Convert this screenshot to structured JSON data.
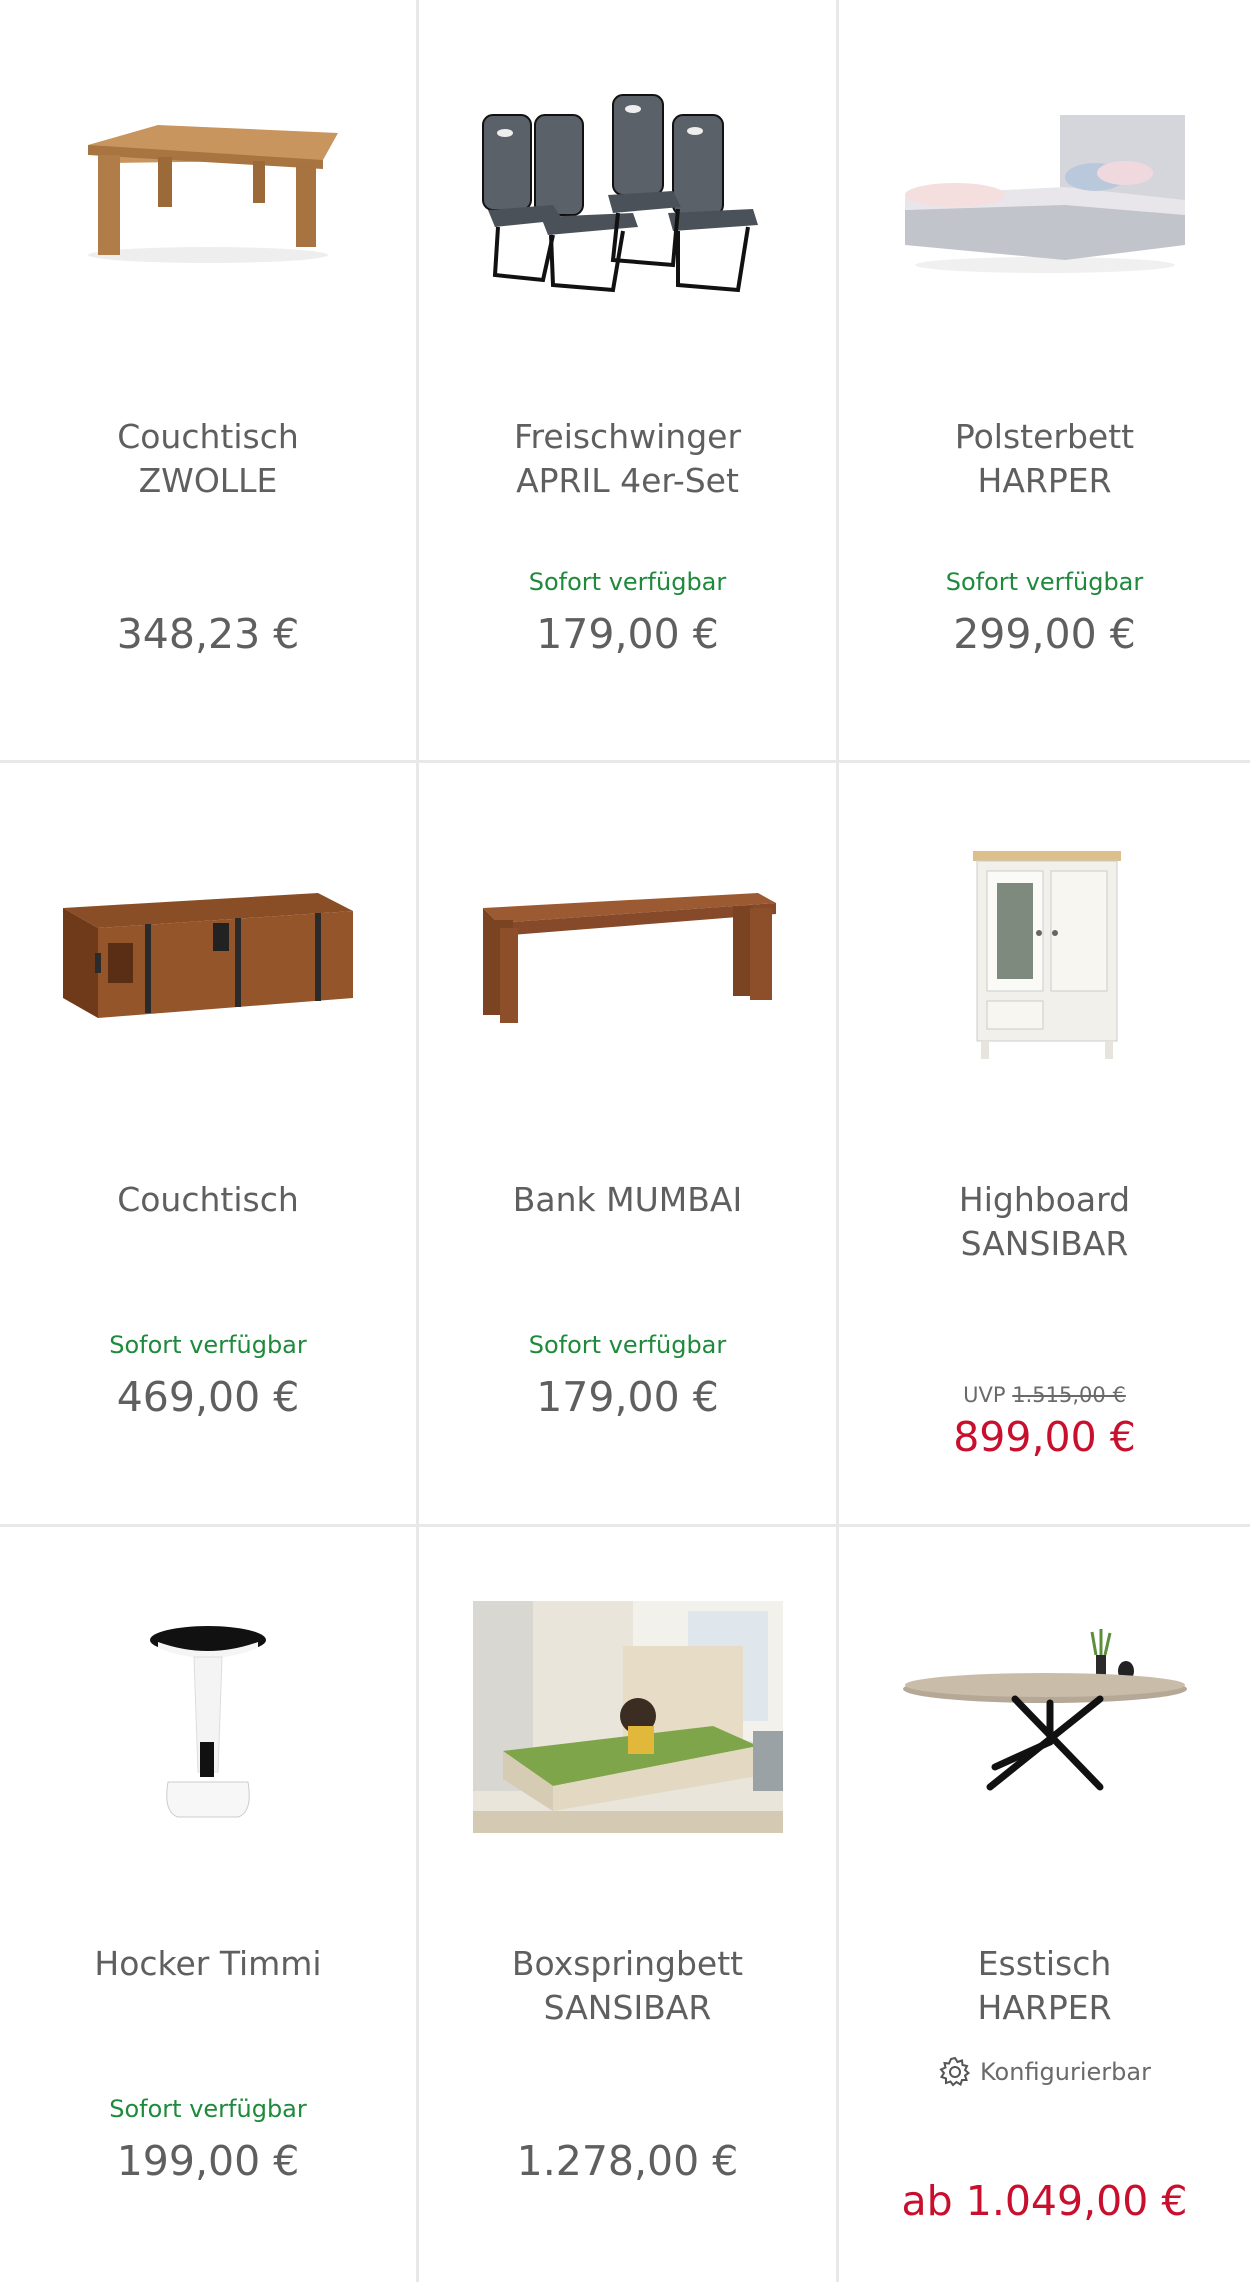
{
  "products": [
    {
      "title": "Couchtisch\nZWOLLE",
      "title_lines": [
        "Couchtisch",
        "ZWOLLE"
      ],
      "availability": "",
      "price": "348,23 €",
      "image_icon": "coffee-table-image"
    },
    {
      "title_lines": [
        "Freischwinger",
        "APRIL 4er-Set"
      ],
      "availability": "Sofort verfügbar",
      "price": "179,00 €",
      "image_icon": "chairs-set-image"
    },
    {
      "title_lines": [
        "Polsterbett",
        "HARPER"
      ],
      "availability": "Sofort verfügbar",
      "price": "299,00 €",
      "image_icon": "upholstered-bed-image"
    },
    {
      "title_lines": [
        "Couchtisch"
      ],
      "availability": "Sofort verfügbar",
      "price": "469,00 €",
      "image_icon": "chest-table-image"
    },
    {
      "title_lines": [
        "Bank MUMBAI"
      ],
      "availability": "Sofort verfügbar",
      "price": "179,00 €",
      "image_icon": "bench-image"
    },
    {
      "title_lines": [
        "Highboard",
        "SANSIBAR"
      ],
      "availability": "",
      "uvp_label": "UVP",
      "uvp_price": "1.515,00 €",
      "price": "899,00 €",
      "price_color": "#c8102e",
      "image_icon": "highboard-image"
    },
    {
      "title_lines": [
        "Hocker Timmi"
      ],
      "availability": "Sofort verfügbar",
      "price": "199,00 €",
      "image_icon": "stool-image"
    },
    {
      "title_lines": [
        "Boxspringbett",
        "SANSIBAR"
      ],
      "availability": "",
      "price": "1.278,00 €",
      "image_icon": "boxspring-bed-photo"
    },
    {
      "title_lines": [
        "Esstisch",
        "HARPER"
      ],
      "configurable_label": "Konfigurierbar",
      "availability": "",
      "price": "ab 1.049,00 €",
      "price_color": "#c8102e",
      "image_icon": "dining-table-image"
    }
  ],
  "colors": {
    "available": "#1e8a3c",
    "sale": "#c8102e",
    "text": "#5f5f5f",
    "divider": "#e8e8e8"
  }
}
